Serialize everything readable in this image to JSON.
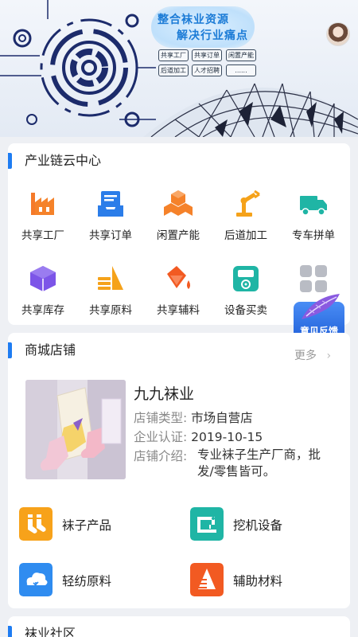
{
  "banner": {
    "slogan_line1": "整合袜业资源",
    "slogan_line2": "解决行业痛点",
    "tags": [
      "共享工厂",
      "共享订单",
      "闲置产能",
      "后道加工",
      "人才招聘",
      "......"
    ]
  },
  "cloud_center": {
    "title": "产业链云中心",
    "items": [
      {
        "label": "共享工厂",
        "icon": "factory-icon"
      },
      {
        "label": "共享订单",
        "icon": "order-tray-icon"
      },
      {
        "label": "闲置产能",
        "icon": "boxes-icon"
      },
      {
        "label": "后道加工",
        "icon": "robot-arm-icon"
      },
      {
        "label": "专车拼单",
        "icon": "truck-icon"
      },
      {
        "label": "共享库存",
        "icon": "cube-icon"
      },
      {
        "label": "共享原料",
        "icon": "layers-icon"
      },
      {
        "label": "共享辅料",
        "icon": "paint-bucket-icon"
      },
      {
        "label": "设备买卖",
        "icon": "scale-device-icon"
      },
      {
        "label": "",
        "icon": "more-grid-icon"
      }
    ],
    "feedback_label": "意见反馈"
  },
  "mall": {
    "title": "商城店铺",
    "more_label": "更多",
    "shop": {
      "name": "九九袜业",
      "type_key": "店铺类型:",
      "type_value": "市场自营店",
      "cert_key": "企业认证:",
      "cert_value": "2019-10-15",
      "intro_key": "店铺介绍:",
      "intro_value": "专业袜子生产厂商，批发/零售皆可。"
    },
    "categories": [
      {
        "label": "袜子产品",
        "icon": "socks-icon",
        "color": "#f7a21a"
      },
      {
        "label": "挖机设备",
        "icon": "sewing-machine-icon",
        "color": "#1fb5a5"
      },
      {
        "label": "轻纺原料",
        "icon": "cloud-leaf-icon",
        "color": "#2f8cf0"
      },
      {
        "label": "辅助材料",
        "icon": "cone-icon",
        "color": "#f25a22"
      }
    ]
  },
  "community": {
    "title": "袜业社区"
  },
  "colors": {
    "accent": "#1e7cf2",
    "orange": "#f5822a",
    "blue": "#2b7de9",
    "teal": "#1fb5a5",
    "purple": "#7c55e8"
  }
}
